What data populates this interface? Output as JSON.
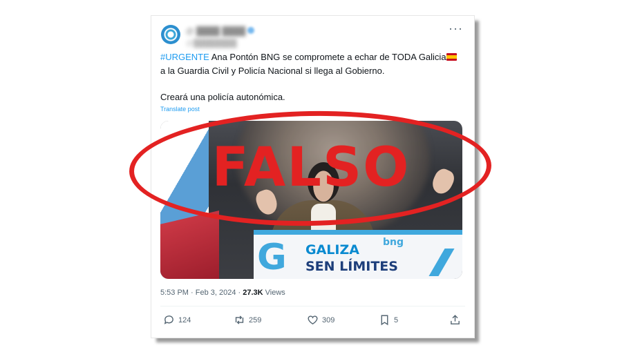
{
  "tweet": {
    "hashtag": "#URGENTE",
    "text_line1": " Ana Pontón BNG se compromete a echar de TODA Galicia",
    "text_line2": "a la Guardia Civil y Policía Nacional si llega al Gobierno.",
    "text_para2": "Creará una policía autonómica.",
    "translate_label": "Translate post",
    "more_label": "···"
  },
  "media": {
    "podium_letter": "G",
    "podium_line1": "GALIZA",
    "podium_line2": "SEN LÍMITES",
    "podium_brand": "bng"
  },
  "meta": {
    "time": "5:53 PM",
    "sep": " · ",
    "date": "Feb 3, 2024",
    "views_count": "27.3K",
    "views_label": " Views"
  },
  "actions": {
    "replies": "124",
    "reposts": "259",
    "likes": "309",
    "bookmarks": "5"
  },
  "stamp": {
    "label": "FALSO",
    "color": "#e32222"
  },
  "colors": {
    "link": "#1d9bf0",
    "text": "#0f1419",
    "muted": "#536471"
  },
  "icons": [
    "reply-icon",
    "repost-icon",
    "like-icon",
    "bookmark-icon",
    "share-icon",
    "more-icon"
  ]
}
